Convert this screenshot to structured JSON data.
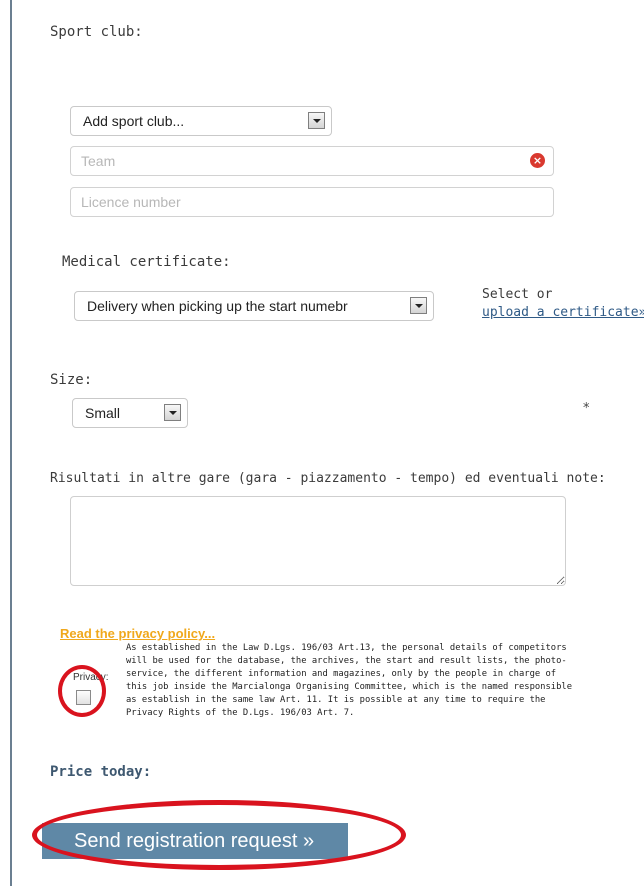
{
  "form": {
    "sport_club_label": "Sport club:",
    "sport_club_select": "Add sport club...",
    "team_placeholder": "Team",
    "licence_placeholder": "Licence number",
    "medical_label": "Medical certificate:",
    "medical_select": "Delivery when picking up the start numebr",
    "select_or": "Select or",
    "upload_link": "upload a certificate»",
    "size_label": "Size:",
    "size_select": "Small",
    "required_mark": "*",
    "results_label": "Risultati in altre gare (gara - piazzamento - tempo) ed eventuali note:",
    "privacy_link": "Read the privacy policy...",
    "privacy_label": "Privacy:",
    "privacy_text": "As established in the Law D.Lgs. 196/03 Art.13, the personal details of competitors will be used for the database, the archives, the start and result lists, the photo-service, the different information and magazines, only by the people in charge of this job inside the Marcialonga Organising Committee, which is the named responsible as establish in the same law Art. 11. It is possible at any time to require the Privacy Rights of the D.Lgs. 196/03 Art. 7.",
    "price_label": "Price today:",
    "send_button": "Send registration request »"
  },
  "colors": {
    "accent": "#5f88a6",
    "privacy_link": "#f0a81c",
    "annotation_red": "#d9131e"
  }
}
